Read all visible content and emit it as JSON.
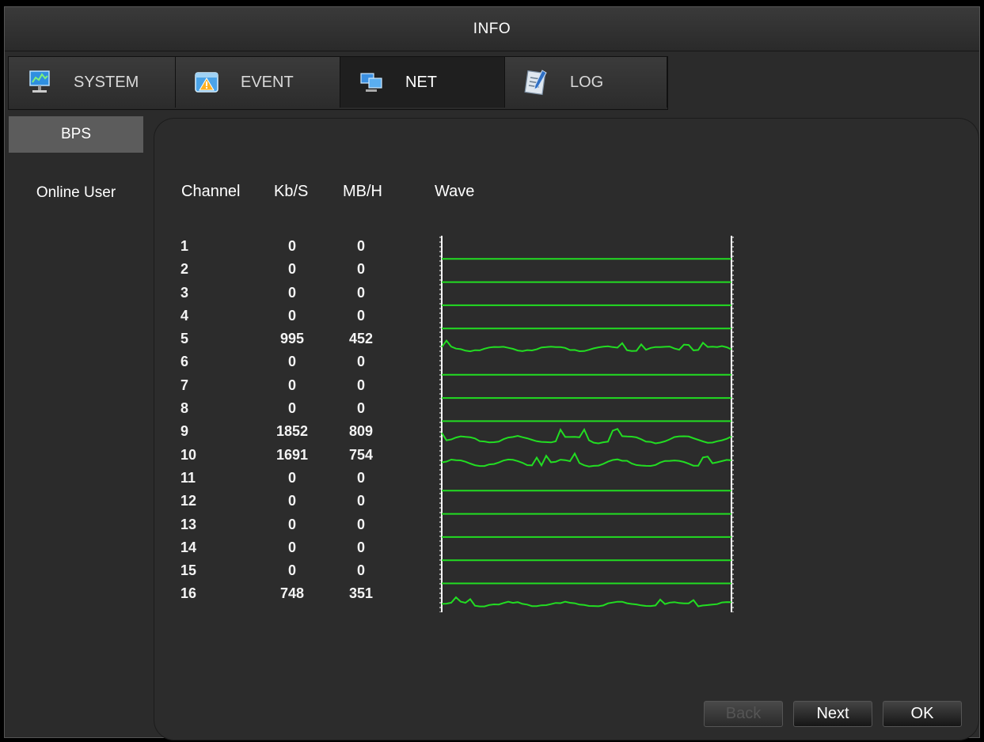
{
  "window": {
    "title": "INFO"
  },
  "tabs": [
    {
      "label": "SYSTEM",
      "icon": "system-monitor-icon",
      "active": false
    },
    {
      "label": "EVENT",
      "icon": "event-warning-icon",
      "active": false
    },
    {
      "label": "NET",
      "icon": "network-icon",
      "active": true
    },
    {
      "label": "LOG",
      "icon": "log-notepad-icon",
      "active": false
    }
  ],
  "sidebar": {
    "items": [
      {
        "label": "BPS",
        "active": true
      },
      {
        "label": "Online User",
        "active": false
      }
    ]
  },
  "table": {
    "headers": {
      "channel": "Channel",
      "kbs": "Kb/S",
      "mbh": "MB/H",
      "wave": "Wave"
    },
    "rows": [
      {
        "channel": "1",
        "kbs": "0",
        "mbh": "0"
      },
      {
        "channel": "2",
        "kbs": "0",
        "mbh": "0"
      },
      {
        "channel": "3",
        "kbs": "0",
        "mbh": "0"
      },
      {
        "channel": "4",
        "kbs": "0",
        "mbh": "0"
      },
      {
        "channel": "5",
        "kbs": "995",
        "mbh": "452"
      },
      {
        "channel": "6",
        "kbs": "0",
        "mbh": "0"
      },
      {
        "channel": "7",
        "kbs": "0",
        "mbh": "0"
      },
      {
        "channel": "8",
        "kbs": "0",
        "mbh": "0"
      },
      {
        "channel": "9",
        "kbs": "1852",
        "mbh": "809"
      },
      {
        "channel": "10",
        "kbs": "1691",
        "mbh": "754"
      },
      {
        "channel": "11",
        "kbs": "0",
        "mbh": "0"
      },
      {
        "channel": "12",
        "kbs": "0",
        "mbh": "0"
      },
      {
        "channel": "13",
        "kbs": "0",
        "mbh": "0"
      },
      {
        "channel": "14",
        "kbs": "0",
        "mbh": "0"
      },
      {
        "channel": "15",
        "kbs": "0",
        "mbh": "0"
      },
      {
        "channel": "16",
        "kbs": "748",
        "mbh": "351"
      }
    ]
  },
  "buttons": {
    "back": "Back",
    "next": "Next",
    "ok": "OK"
  },
  "colors": {
    "wave": "#22dd22",
    "background": "#2b2b2b",
    "active_sidebar": "#5c5c5c"
  }
}
